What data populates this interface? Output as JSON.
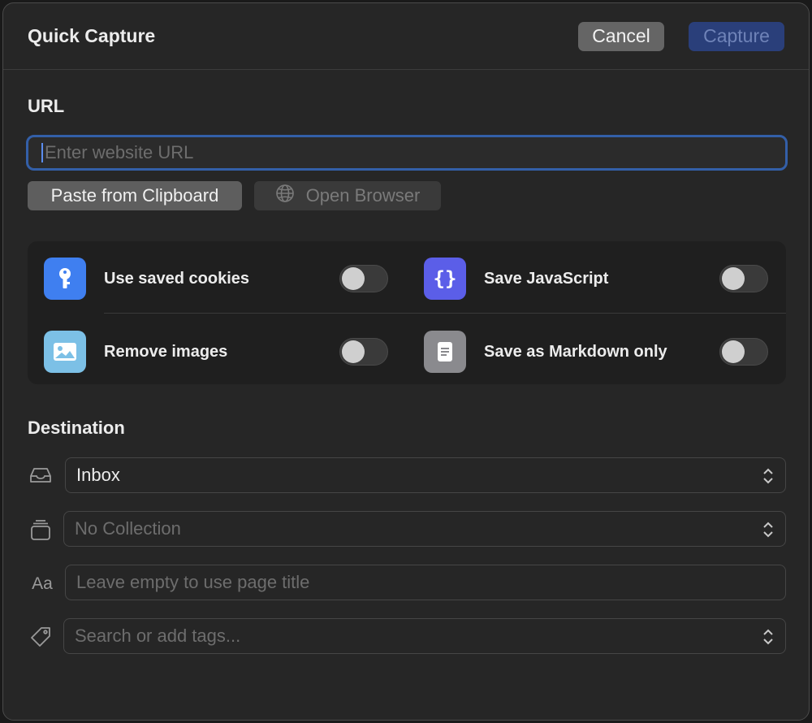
{
  "header": {
    "title": "Quick Capture",
    "cancel_label": "Cancel",
    "capture_label": "Capture"
  },
  "url_section": {
    "label": "URL",
    "input_value": "",
    "input_placeholder": "Enter website URL",
    "paste_label": "Paste from Clipboard",
    "open_browser_label": "Open Browser"
  },
  "options": [
    {
      "label": "Use saved cookies",
      "icon": "key-icon",
      "color": "#3f7ff0",
      "enabled": false
    },
    {
      "label": "Save JavaScript",
      "icon": "braces-icon",
      "color": "#5b5ee8",
      "enabled": false
    },
    {
      "label": "Remove images",
      "icon": "image-icon",
      "color": "#7cc0e6",
      "enabled": false
    },
    {
      "label": "Save as Markdown only",
      "icon": "document-icon",
      "color": "#8a8a8e",
      "enabled": false
    }
  ],
  "destination": {
    "label": "Destination",
    "folder_value": "Inbox",
    "collection_placeholder": "No Collection",
    "title_icon_label": "Aa",
    "title_placeholder": "Leave empty to use page title",
    "tags_placeholder": "Search or add tags..."
  },
  "colors": {
    "accent": "#335fa8",
    "capture_button": "#2a3f7a",
    "background": "#262626"
  }
}
